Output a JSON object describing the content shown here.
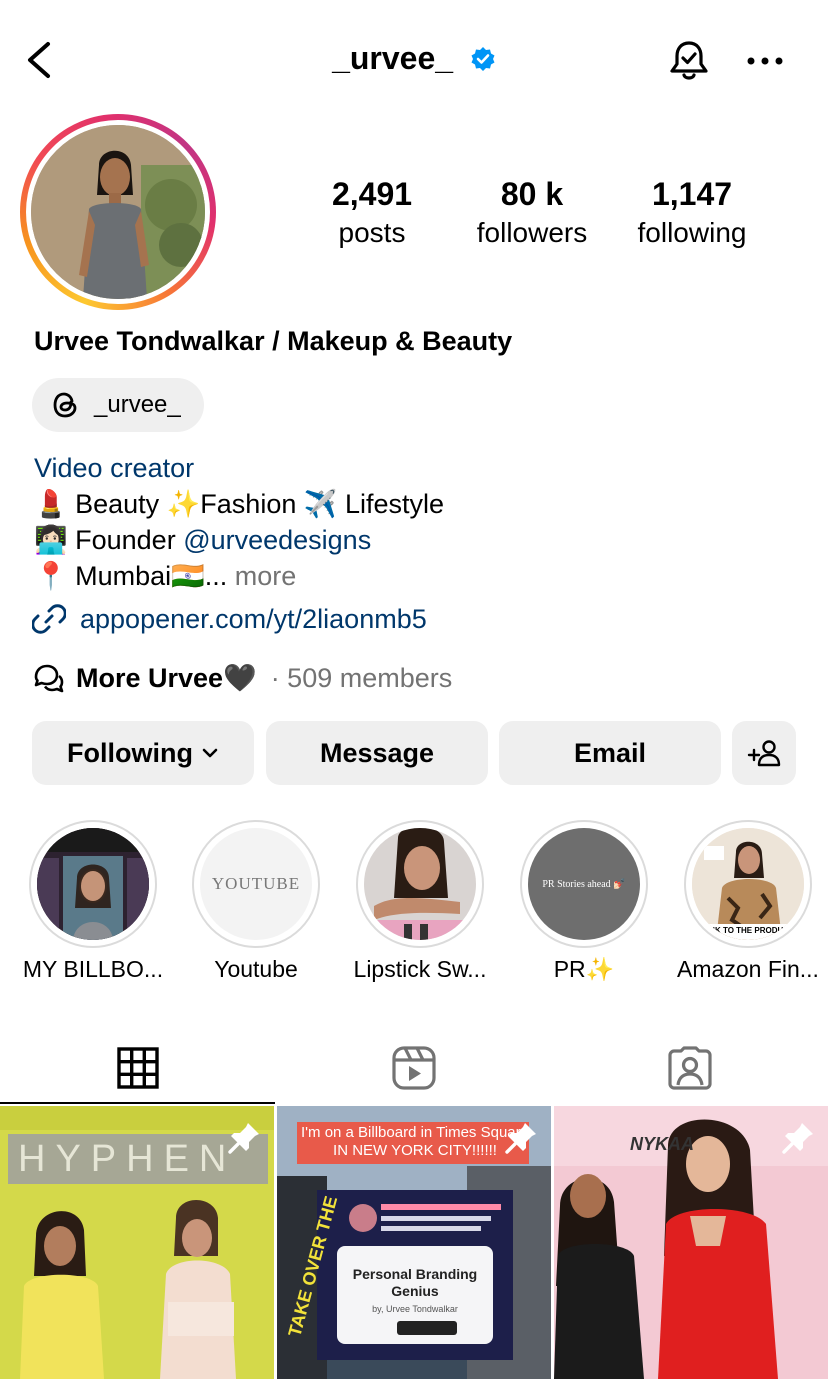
{
  "header": {
    "username": "_urvee_"
  },
  "stats": [
    {
      "num": "2,491",
      "label": "posts"
    },
    {
      "num": "80 k",
      "label": "followers"
    },
    {
      "num": "1,147",
      "label": "following"
    }
  ],
  "profile": {
    "full_name": "Urvee Tondwalkar / Makeup & Beauty",
    "threads_handle": "_urvee_",
    "category": "Video creator",
    "bio_line1": "💄 Beauty ✨Fashion ✈️ Lifestyle",
    "bio_line2_prefix": "👩🏻‍💻 Founder ",
    "bio_line2_mention": "@urveedesigns",
    "bio_line3": "📍 Mumbai🇮🇳...",
    "bio_more": " more",
    "link": "appopener.com/yt/2liaonmb5",
    "channel_name": "More Urvee🖤",
    "channel_members": "· 509 members"
  },
  "buttons": {
    "following": "Following",
    "message": "Message",
    "email": "Email"
  },
  "highlights": [
    {
      "label": "MY BILLBO..."
    },
    {
      "label": "Youtube",
      "cover_text": "YOUTUBE"
    },
    {
      "label": "Lipstick Sw..."
    },
    {
      "label": "PR✨",
      "cover_text": "PR Stories ahead 💅🏻"
    },
    {
      "label": "Amazon Fin...",
      "cover_text": "LINK TO THE PRODUCT"
    }
  ],
  "grid": [
    {
      "overlay": "HYPHEN"
    },
    {
      "overlay_top": "I'm on a Billboard in Times Square IN NEW YORK CITY!!!!!!",
      "billboard_title": "Personal Branding Genius",
      "billboard_by": "by, Urvee Tondwalkar",
      "billboard_side": "TAKE OVER THE"
    },
    {
      "overlay": "NYKAA"
    }
  ],
  "colors": {
    "link": "#00376b",
    "muted": "#737373",
    "button_bg": "#efefef",
    "verified": "#0095f6"
  }
}
